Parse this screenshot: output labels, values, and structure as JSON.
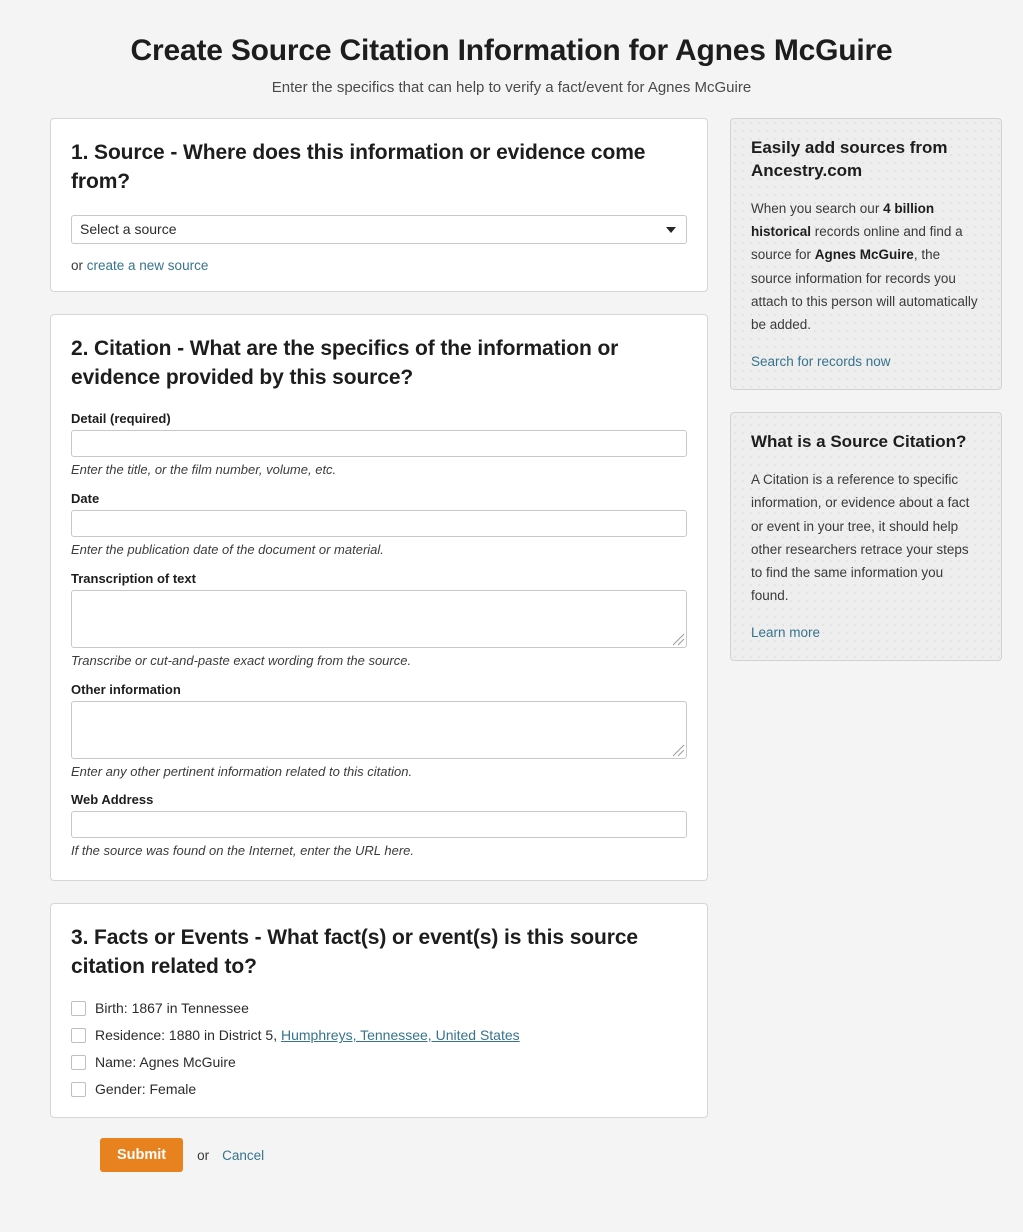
{
  "header": {
    "title": "Create Source Citation Information for Agnes McGuire",
    "subtitle": "Enter the specifics that can help to verify a fact/event for Agnes McGuire"
  },
  "source_section": {
    "heading": "1. Source - Where does this information or evidence come from?",
    "select_value": "Select a source",
    "or_prefix": "or ",
    "create_link": "create a new source"
  },
  "citation_section": {
    "heading": "2. Citation - What are the specifics of the information or evidence provided by this source?",
    "fields": [
      {
        "label": "Detail (required)",
        "value": "",
        "hint": "Enter the title, or the film number, volume, etc."
      },
      {
        "label": "Date",
        "value": "",
        "hint": "Enter the publication date of the document or material."
      },
      {
        "label": "Transcription of text",
        "value": "",
        "hint": "Transcribe or cut-and-paste exact wording from the source."
      },
      {
        "label": "Other information",
        "value": "",
        "hint": "Enter any other pertinent information related to this citation."
      },
      {
        "label": "Web Address",
        "value": "",
        "hint": "If the source was found on the Internet, enter the URL here."
      }
    ]
  },
  "facts_section": {
    "heading": "3. Facts or Events - What fact(s) or event(s) is this source citation related to?",
    "items": [
      {
        "text": "Birth: 1867 in Tennessee",
        "place": "",
        "checked": false
      },
      {
        "text": "Residence: 1880 in District 5, ",
        "place": "Humphreys, Tennessee, United States",
        "checked": false
      },
      {
        "text": "Name: Agnes McGuire",
        "place": "",
        "checked": false
      },
      {
        "text": "Gender: Female",
        "place": "",
        "checked": false
      }
    ]
  },
  "sidebar": {
    "ancestry_card": {
      "title": "Easily add sources from Ancestry.com",
      "body_1": "When you search our ",
      "bold_1": "4 billion historical",
      "body_2": " records online and find a source for ",
      "bold_2": "Agnes McGuire",
      "body_3": ", the source information for records you attach to this person will automatically be added.",
      "link": "Search for records now"
    },
    "citation_card": {
      "title": "What is a Source Citation?",
      "body": "A Citation is a reference to specific information, or evidence about a fact or event in your tree, it should help other researchers retrace your steps to find the same information you found.",
      "link": "Learn more"
    }
  },
  "footer": {
    "submit_label": "Submit",
    "or_label": "or",
    "cancel_label": "Cancel"
  },
  "colors": {
    "accent_orange": "#e8821e",
    "link_teal": "#36748d",
    "page_background": "#f4f4f4"
  }
}
